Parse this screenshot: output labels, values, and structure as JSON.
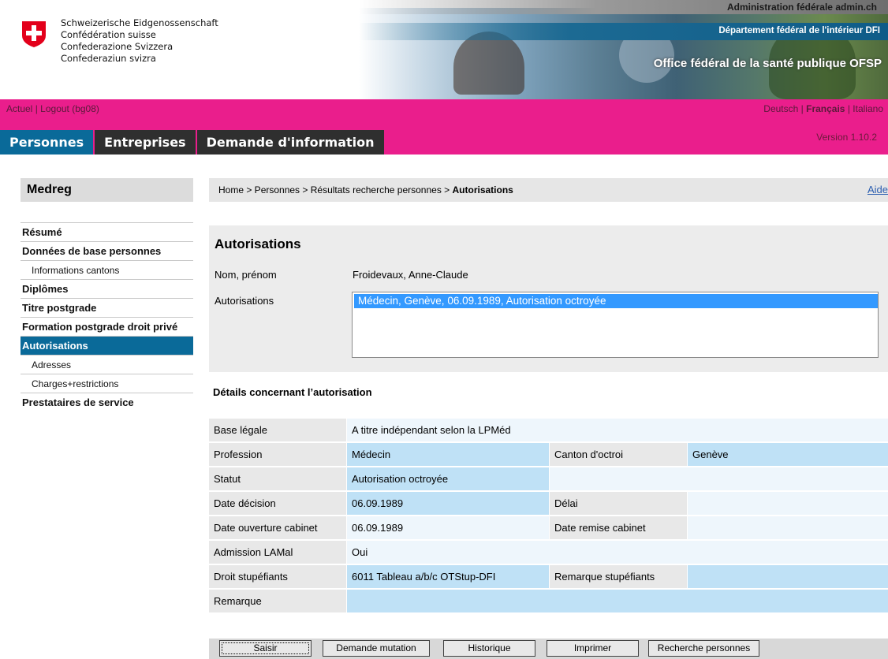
{
  "header": {
    "confederation": [
      "Schweizerische Eidgenossenschaft",
      "Confédération suisse",
      "Confederazione Svizzera",
      "Confederaziun svizra"
    ],
    "admin": "Administration fédérale admin.ch",
    "department": "Département fédéral de l'intérieur DFI",
    "office": "Office fédéral de la santé publique OFSP"
  },
  "topbar": {
    "actuel": "Actuel",
    "logout": "Logout (bg08)",
    "lang_de": "Deutsch",
    "lang_fr": "Français",
    "lang_it": "Italiano",
    "version": "Version 1.10.2"
  },
  "tabs": [
    {
      "label": "Personnes"
    },
    {
      "label": "Entreprises"
    },
    {
      "label": "Demande d'information"
    }
  ],
  "sidebar": {
    "title": "Medreg",
    "items": [
      {
        "label": "Résumé"
      },
      {
        "label": "Données de base personnes"
      },
      {
        "label": "Informations cantons"
      },
      {
        "label": "Diplômes"
      },
      {
        "label": "Titre postgrade"
      },
      {
        "label": "Formation postgrade droit privé"
      },
      {
        "label": "Autorisations"
      },
      {
        "label": "Adresses"
      },
      {
        "label": "Charges+restrictions"
      },
      {
        "label": "Prestataires de service"
      }
    ]
  },
  "breadcrumb": {
    "path": "Home > Personnes > Résultats recherche personnes > ",
    "current": "Autorisations",
    "help": "Aide"
  },
  "authorizations": {
    "title": "Autorisations",
    "name_label": "Nom, prénom",
    "name_value": "Froidevaux, Anne-Claude",
    "list_label": "Autorisations",
    "list_items": [
      "Médecin, Genève, 06.09.1989, Autorisation octroyée"
    ]
  },
  "details": {
    "title": "Détails concernant l’autorisation",
    "base_legale_label": "Base légale",
    "base_legale_value": "A titre indépendant selon la LPMéd",
    "profession_label": "Profession",
    "profession_value": "Médecin",
    "canton_label": "Canton d'octroi",
    "canton_value": "Genève",
    "statut_label": "Statut",
    "statut_value": "Autorisation octroyée",
    "date_decision_label": "Date décision",
    "date_decision_value": "06.09.1989",
    "delai_label": "Délai",
    "delai_value": "",
    "date_ouverture_label": "Date ouverture cabinet",
    "date_ouverture_value": "06.09.1989",
    "date_remise_label": "Date remise cabinet",
    "date_remise_value": "",
    "lamal_label": "Admission LAMal",
    "lamal_value": "Oui",
    "stupefiants_label": "Droit stupéfiants",
    "stupefiants_value": "6011 Tableau a/b/c OTStup-DFI",
    "rem_stup_label": "Remarque stupéfiants",
    "rem_stup_value": "",
    "remarque_label": "Remarque",
    "remarque_value": ""
  },
  "buttons": {
    "saisir": "Saisir",
    "mutation": "Demande mutation",
    "historique": "Historique",
    "imprimer": "Imprimer",
    "recherche": "Recherche personnes"
  },
  "colors": {
    "accent_pink": "#ea1e8c",
    "nav_blue": "#0a6a99",
    "value_blue": "#bfe1f6"
  }
}
